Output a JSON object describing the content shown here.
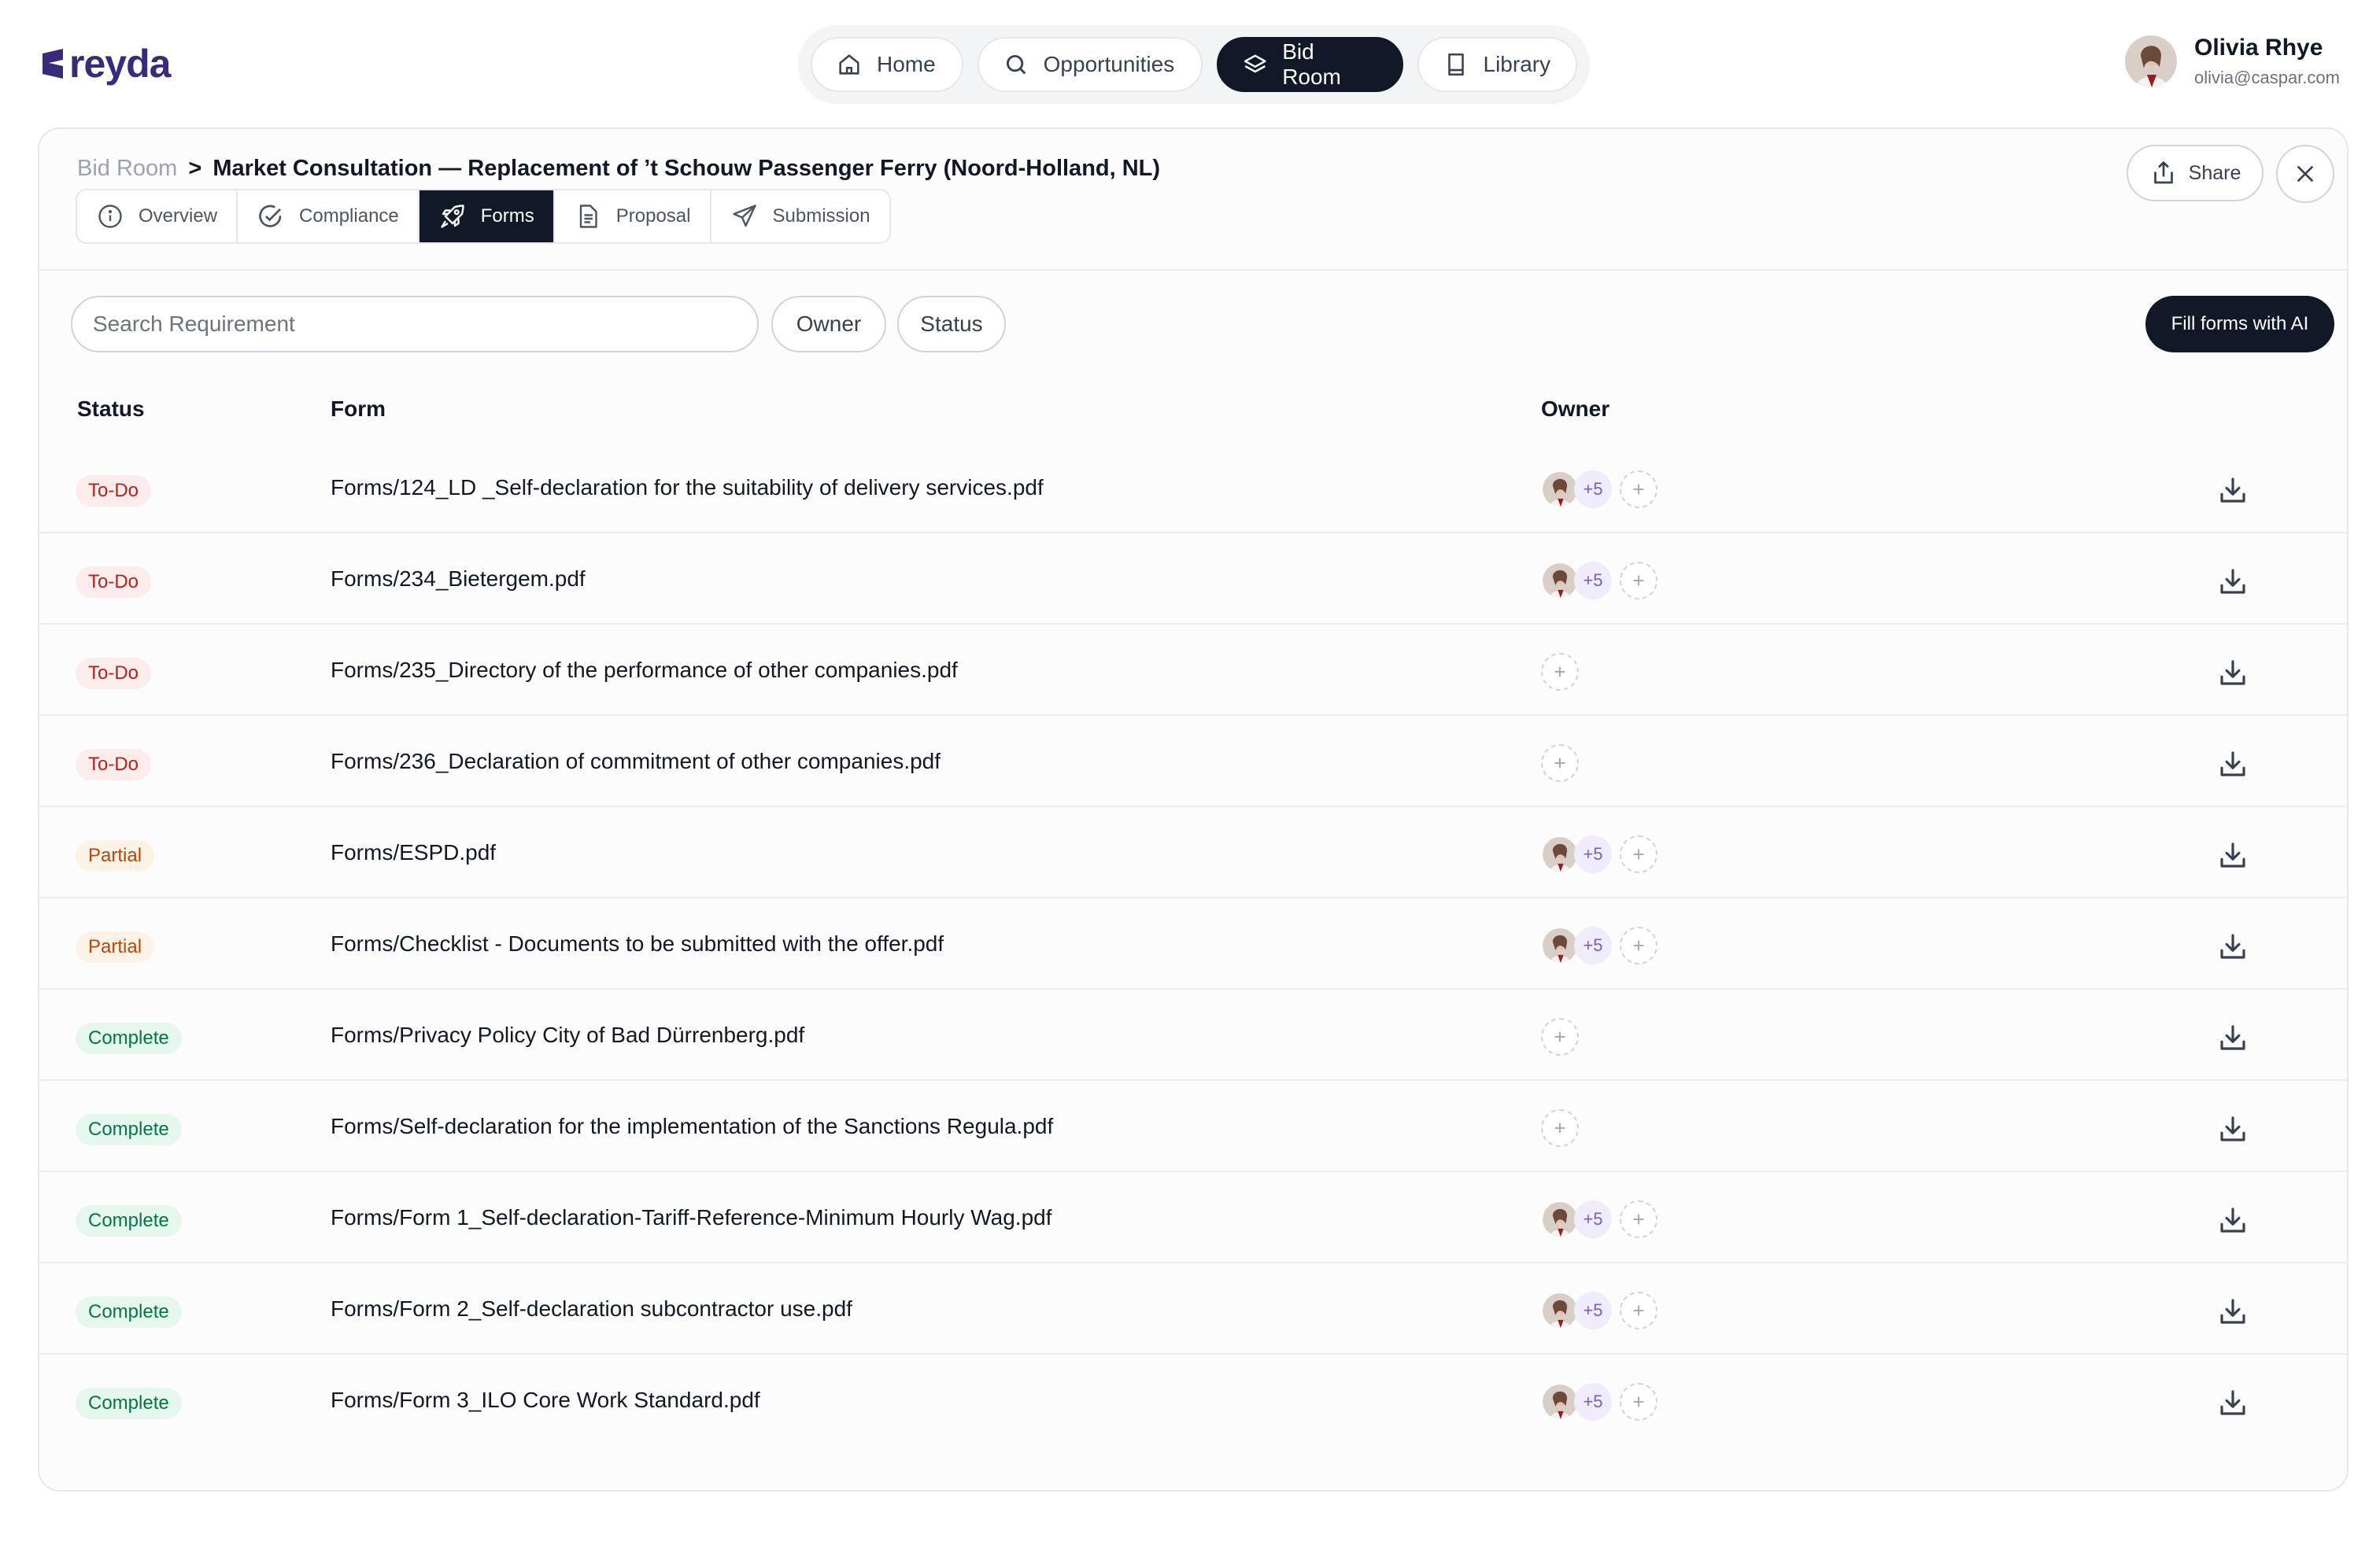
{
  "brand": {
    "name": "reyda",
    "color": "#3b2a7a"
  },
  "nav": [
    {
      "label": "Home",
      "icon": "home-icon"
    },
    {
      "label": "Opportunities",
      "icon": "search-icon"
    },
    {
      "label": "Bid Room",
      "icon": "layers-icon",
      "active": true
    },
    {
      "label": "Library",
      "icon": "book-icon"
    }
  ],
  "user": {
    "name": "Olivia Rhye",
    "email": "olivia@caspar.com"
  },
  "breadcrumb": {
    "root": "Bid Room",
    "separator": ">",
    "current": "Market Consultation — Replacement of ’t Schouw Passenger Ferry (Noord-Holland, NL)"
  },
  "tabs": [
    {
      "label": "Overview",
      "icon": "info-icon"
    },
    {
      "label": "Compliance",
      "icon": "check-circle-icon"
    },
    {
      "label": "Forms",
      "icon": "rocket-icon",
      "active": true
    },
    {
      "label": "Proposal",
      "icon": "document-icon"
    },
    {
      "label": "Submission",
      "icon": "send-icon"
    }
  ],
  "actions": {
    "share": "Share",
    "fill_ai": "Fill forms with AI"
  },
  "filters": {
    "search_placeholder": "Search Requirement",
    "owner": "Owner",
    "status": "Status"
  },
  "table": {
    "headers": {
      "status": "Status",
      "form": "Form",
      "owner": "Owner"
    },
    "rows": [
      {
        "status": "To-Do",
        "type": "todo",
        "form": "Forms/124_LD _Self-declaration for the suitability of delivery services.pdf",
        "more": "+5"
      },
      {
        "status": "To-Do",
        "type": "todo",
        "form": "Forms/234_Bietergem.pdf",
        "more": "+5"
      },
      {
        "status": "To-Do",
        "type": "todo",
        "form": "Forms/235_Directory of the performance of other companies.pdf",
        "more": ""
      },
      {
        "status": "To-Do",
        "type": "todo",
        "form": "Forms/236_Declaration of commitment of other companies.pdf",
        "more": ""
      },
      {
        "status": "Partial",
        "type": "partial",
        "form": "Forms/ESPD.pdf",
        "more": "+5"
      },
      {
        "status": "Partial",
        "type": "partial",
        "form": "Forms/Checklist - Documents to be submitted with the offer.pdf",
        "more": "+5"
      },
      {
        "status": "Complete",
        "type": "complete",
        "form": "Forms/Privacy Policy City of Bad Dürrenberg.pdf",
        "more": ""
      },
      {
        "status": "Complete",
        "type": "complete",
        "form": "Forms/Self-declaration for the implementation of the Sanctions Regula.pdf",
        "more": ""
      },
      {
        "status": "Complete",
        "type": "complete",
        "form": "Forms/Form 1_Self-declaration-Tariff-Reference-Minimum Hourly Wag.pdf",
        "more": "+5"
      },
      {
        "status": "Complete",
        "type": "complete",
        "form": "Forms/Form 2_Self-declaration subcontractor use.pdf",
        "more": "+5"
      },
      {
        "status": "Complete",
        "type": "complete",
        "form": "Forms/Form 3_ILO Core Work Standard.pdf",
        "more": "+5"
      }
    ]
  }
}
